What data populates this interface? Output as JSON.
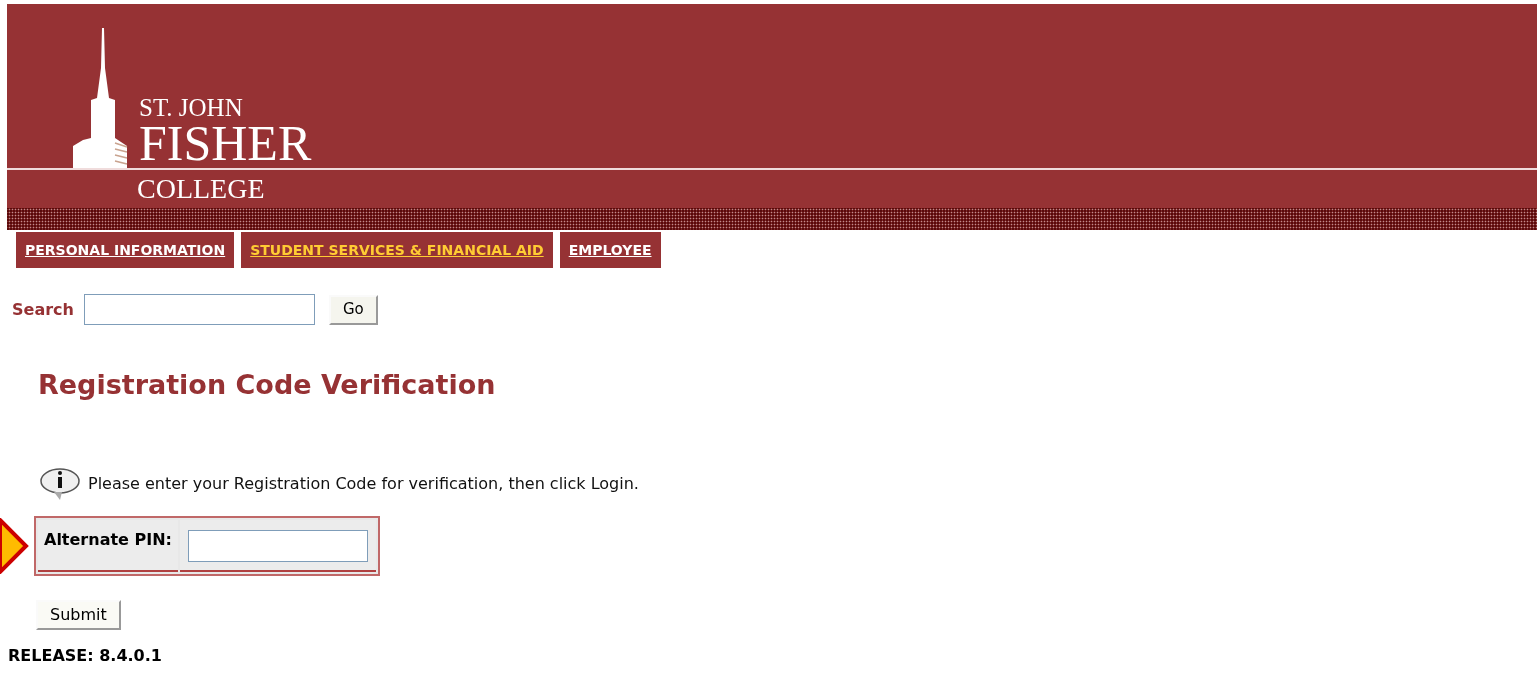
{
  "logo": {
    "line_1": "ST. JOHN",
    "line_2": "FISHER",
    "line_3": "COLLEGE"
  },
  "tabs": [
    {
      "label": "PERSONAL INFORMATION",
      "selected": false
    },
    {
      "label": "STUDENT SERVICES & FINANCIAL AID",
      "selected": true
    },
    {
      "label": "EMPLOYEE",
      "selected": false
    }
  ],
  "search": {
    "label": "Search",
    "button": "Go"
  },
  "page_title": "Registration Code Verification",
  "info_message": "Please enter your Registration Code for verification, then click Login.",
  "form": {
    "field_label": "Alternate PIN:"
  },
  "submit_button": "Submit",
  "release": "RELEASE: 8.4.0.1"
}
